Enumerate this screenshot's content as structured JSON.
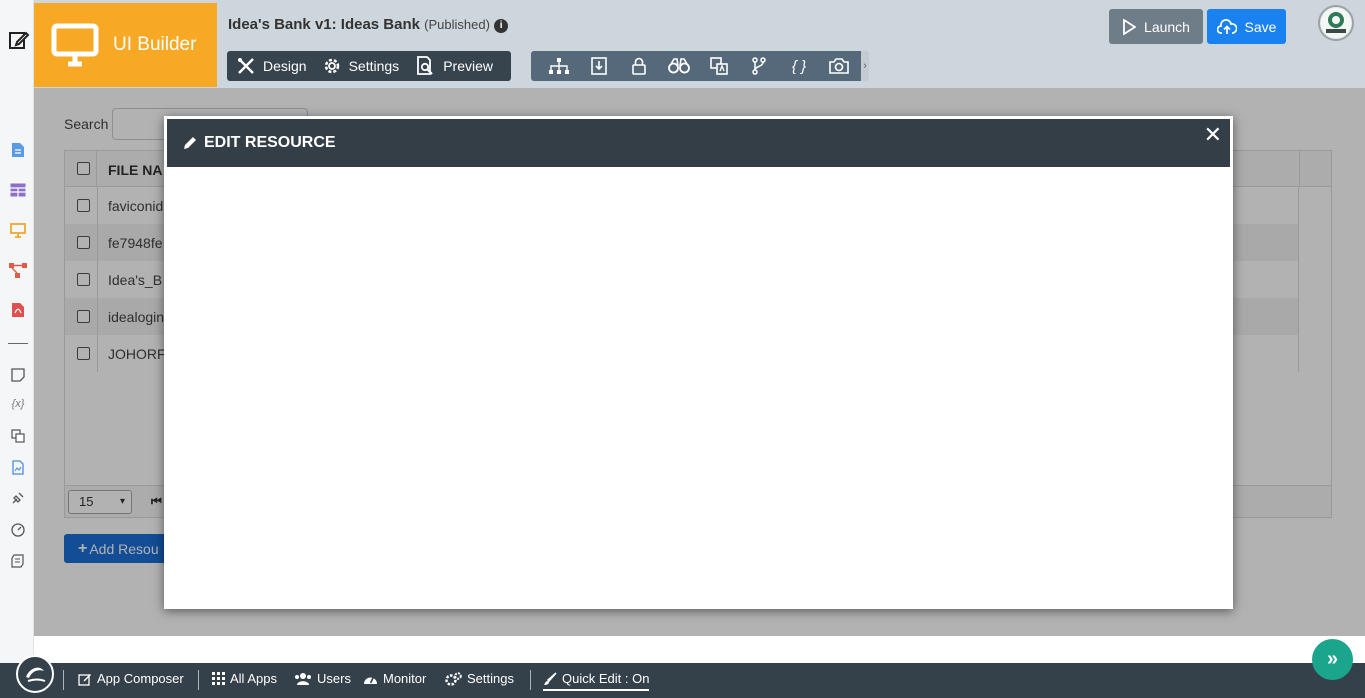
{
  "header": {
    "brand": "UI Builder",
    "app_title": "Idea's Bank v1: Ideas Bank",
    "app_status": "(Published)",
    "info_glyph": "i",
    "mode_tabs": [
      {
        "label": "Design",
        "icon": "design-tools-icon"
      },
      {
        "label": "Settings",
        "icon": "gear-icon"
      },
      {
        "label": "Preview",
        "icon": "preview-icon"
      }
    ],
    "tools": [
      {
        "icon": "sitemap-icon",
        "glyph": "⊞"
      },
      {
        "icon": "import-icon",
        "glyph": "⇩"
      },
      {
        "icon": "lock-icon",
        "glyph": "🔒"
      },
      {
        "icon": "binoculars-icon",
        "glyph": "∞"
      },
      {
        "icon": "translate-icon",
        "glyph": "文"
      },
      {
        "icon": "branch-icon",
        "glyph": "⑂"
      },
      {
        "icon": "braces-icon",
        "glyph": "{ }"
      },
      {
        "icon": "camera-icon",
        "glyph": "📷"
      }
    ],
    "tools_more": "›",
    "launch_label": "Launch",
    "save_label": "Save"
  },
  "content": {
    "search_label": "Search",
    "column_header": "FILE NA",
    "rows": [
      {
        "name": "faviconid"
      },
      {
        "name": "fe7948fe"
      },
      {
        "name": "Idea's_B"
      },
      {
        "name": "idealogin"
      },
      {
        "name": "JOHORF"
      }
    ],
    "page_size": "15",
    "pager_first": "⏮",
    "add_button": "Add Resou"
  },
  "modal": {
    "title": "EDIT RESOURCE",
    "close_glyph": "✕"
  },
  "bottom_bar": {
    "items": [
      {
        "label": "App Composer",
        "icon": "edit-icon"
      },
      {
        "label": "All Apps",
        "icon": "grid-icon"
      },
      {
        "label": "Users",
        "icon": "users-icon"
      },
      {
        "label": "Monitor",
        "icon": "gauge-icon"
      },
      {
        "label": "Settings",
        "icon": "gears-icon"
      },
      {
        "label": "Quick Edit : On",
        "icon": "brush-icon"
      }
    ],
    "expand_glyph": "»"
  },
  "colors": {
    "brand_orange": "#f7a925",
    "header_bg": "#ced6dd",
    "dark_slate": "#343e46",
    "save_blue": "#1a82f0",
    "launch_gray": "#6f7d89",
    "accent_teal": "#1aa58c"
  }
}
